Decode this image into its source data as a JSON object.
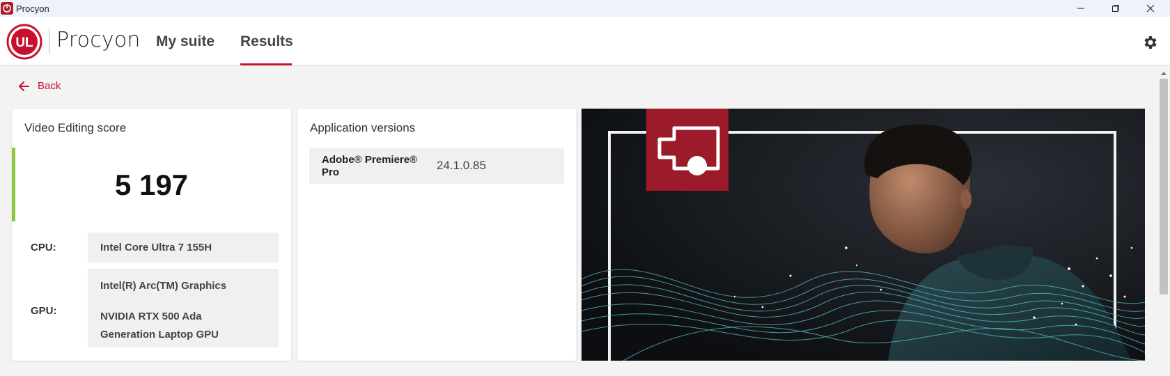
{
  "window": {
    "title": "Procyon",
    "icons": [
      "app-logo-icon",
      "minimize-icon",
      "restore-icon",
      "close-icon"
    ]
  },
  "header": {
    "brand": "Procyon",
    "logo_text": "UL",
    "nav": [
      {
        "label": "My suite",
        "active": false
      },
      {
        "label": "Results",
        "active": true
      }
    ],
    "settings_icon": "gear-icon",
    "accent_color": "#c8102e"
  },
  "back": {
    "label": "Back",
    "icon": "arrow-left-icon"
  },
  "score_card": {
    "title": "Video Editing score",
    "score": "5 197",
    "score_accent_color": "#8cc63f",
    "cpu_label": "CPU:",
    "cpu_value": "Intel Core Ultra 7 155H",
    "gpu_label": "GPU:",
    "gpu_values": [
      "Intel(R) Arc(TM) Graphics",
      "NVIDIA RTX 500 Ada",
      "Generation Laptop GPU"
    ]
  },
  "apps_card": {
    "title": "Application versions",
    "rows": [
      {
        "name_line1": "Adobe® Premiere®",
        "name_line2": "Pro",
        "version": "24.1.0.85"
      }
    ]
  },
  "hero": {
    "badge_icon": "video-editing-icon",
    "badge_color": "#9b1b2a",
    "description_icon": "person-with-light-waves"
  }
}
